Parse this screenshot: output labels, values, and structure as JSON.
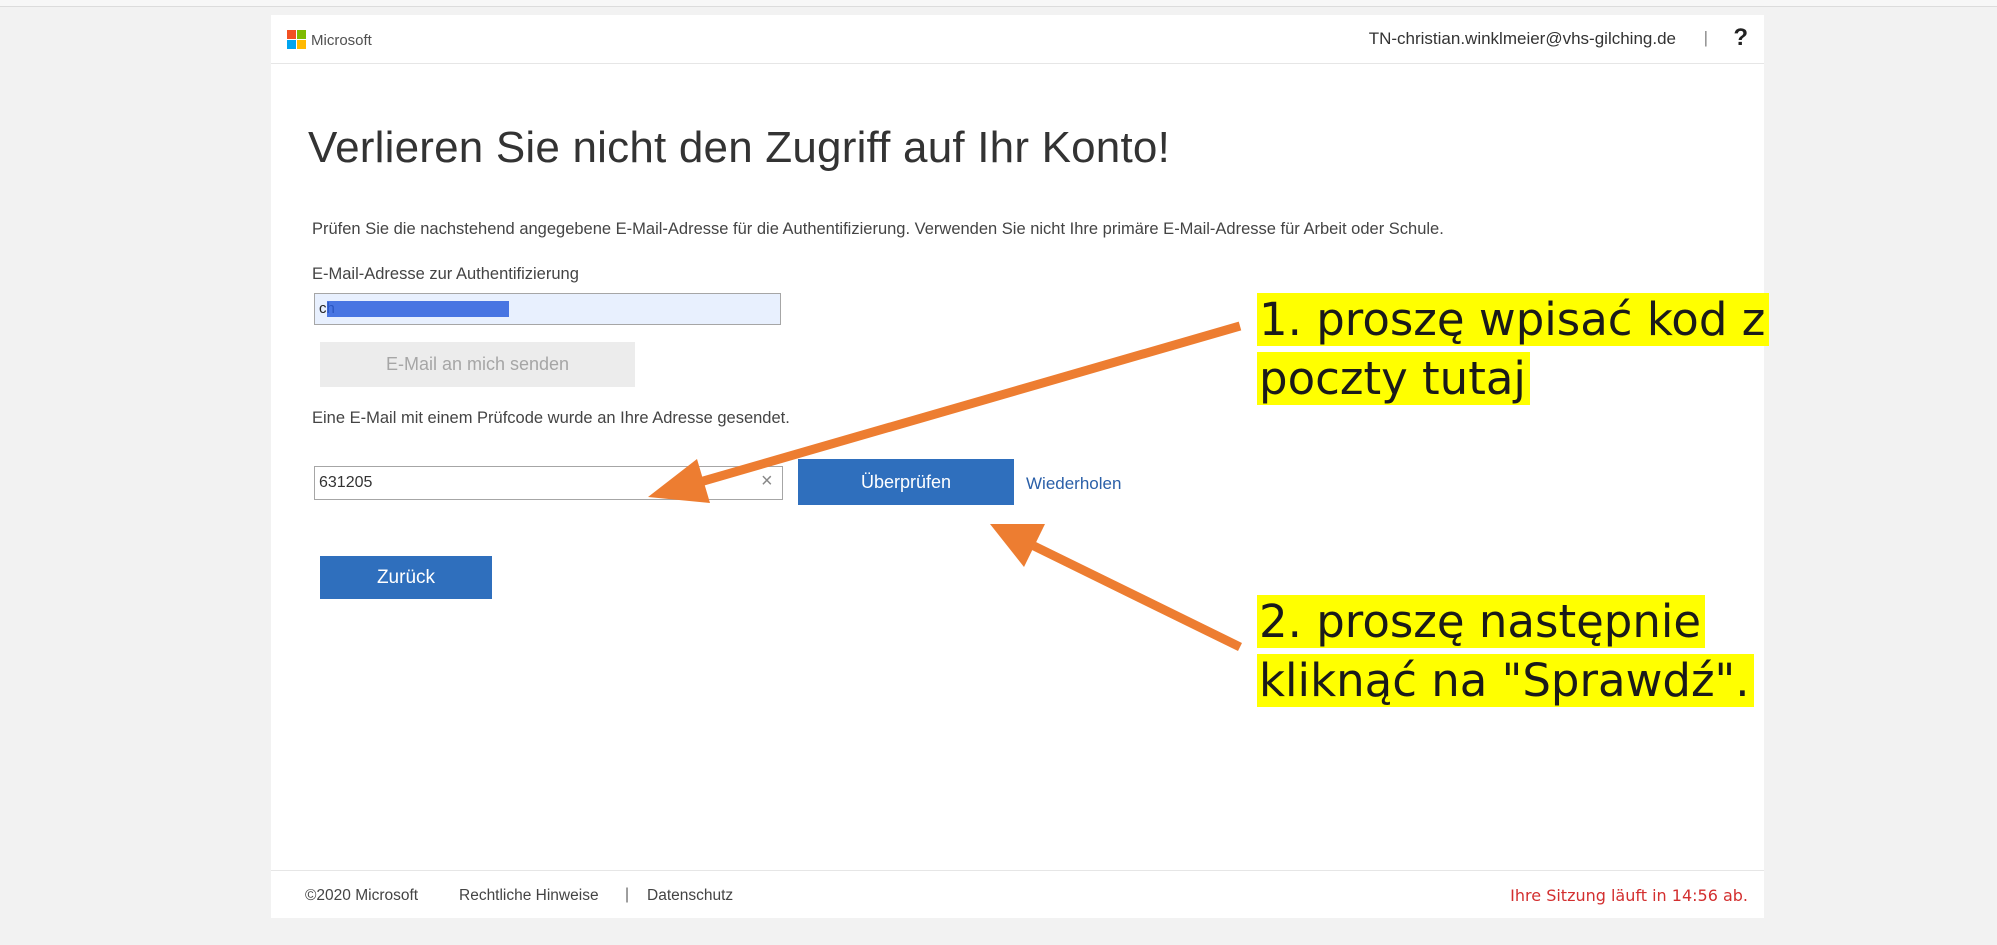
{
  "header": {
    "brand": "Microsoft",
    "user_email": "TN-christian.winklmeier@vhs-gilching.de",
    "separator": "|",
    "help_symbol": "?"
  },
  "main": {
    "title": "Verlieren Sie nicht den Zugriff auf Ihr Konto!",
    "description": "Prüfen Sie die nachstehend angegebene E-Mail-Adresse für die Authentifizierung. Verwenden Sie nicht Ihre primäre E-Mail-Adresse für Arbeit oder Schule.",
    "email_label": "E-Mail-Adresse zur Authentifizierung",
    "email_value": "ch",
    "send_button": "E-Mail an mich senden",
    "sent_info": "Eine E-Mail mit einem Prüfcode wurde an Ihre Adresse gesendet.",
    "code_value": "631205",
    "clear_symbol": "×",
    "verify_button": "Überprüfen",
    "retry_link": "Wiederholen",
    "back_button": "Zurück"
  },
  "footer": {
    "copyright": "©2020 Microsoft",
    "legal": "Rechtliche Hinweise",
    "separator": "|",
    "privacy": "Datenschutz",
    "session": "Ihre Sitzung läuft in 14:56 ab."
  },
  "annotations": {
    "callout1_line1": "1. proszę wpisać kod z",
    "callout1_line2": "poczty tutaj",
    "callout2_line1": "2. proszę następnie",
    "callout2_line2": "kliknąć na \"Sprawdź\".",
    "arrow_color": "#ed7d31",
    "highlight_color": "#ffff00"
  },
  "colors": {
    "accent": "#2f6fbd",
    "link": "#2a5fa8",
    "session_warning": "#d32f2f"
  }
}
